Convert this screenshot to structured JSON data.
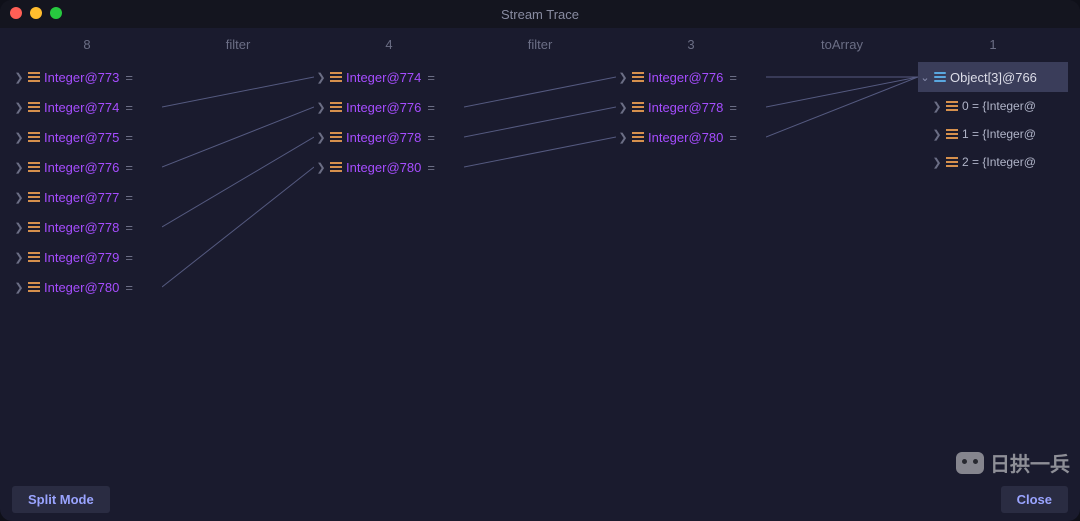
{
  "title": "Stream Trace",
  "headers": {
    "c1": "8",
    "g1": "filter",
    "c2": "4",
    "g2": "filter",
    "c3": "3",
    "g3": "toArray",
    "c4": "1"
  },
  "col1": [
    {
      "label": "Integer@773",
      "suffix": " ="
    },
    {
      "label": "Integer@774",
      "suffix": " ="
    },
    {
      "label": "Integer@775",
      "suffix": " ="
    },
    {
      "label": "Integer@776",
      "suffix": " ="
    },
    {
      "label": "Integer@777",
      "suffix": " ="
    },
    {
      "label": "Integer@778",
      "suffix": " ="
    },
    {
      "label": "Integer@779",
      "suffix": " ="
    },
    {
      "label": "Integer@780",
      "suffix": " ="
    }
  ],
  "col2": [
    {
      "label": "Integer@774",
      "suffix": " ="
    },
    {
      "label": "Integer@776",
      "suffix": " ="
    },
    {
      "label": "Integer@778",
      "suffix": " ="
    },
    {
      "label": "Integer@780",
      "suffix": " ="
    }
  ],
  "col3": [
    {
      "label": "Integer@776",
      "suffix": " ="
    },
    {
      "label": "Integer@778",
      "suffix": " ="
    },
    {
      "label": "Integer@780",
      "suffix": " ="
    }
  ],
  "col4_root": {
    "label": "Object[3]@766"
  },
  "col4_children": [
    {
      "label": "0 = {Integer@"
    },
    {
      "label": "1 = {Integer@"
    },
    {
      "label": "2 = {Integer@"
    }
  ],
  "connections": {
    "gap1": [
      {
        "from": 1,
        "to": 0
      },
      {
        "from": 3,
        "to": 1
      },
      {
        "from": 5,
        "to": 2
      },
      {
        "from": 7,
        "to": 3
      }
    ],
    "gap2": [
      {
        "from": 1,
        "to": 0
      },
      {
        "from": 2,
        "to": 1
      },
      {
        "from": 3,
        "to": 2
      }
    ],
    "gap3": [
      {
        "from": 0,
        "to": 0
      },
      {
        "from": 1,
        "to": 0
      },
      {
        "from": 2,
        "to": 0
      }
    ]
  },
  "buttons": {
    "split": "Split Mode",
    "close": "Close"
  },
  "watermark_text": "日拱一兵"
}
